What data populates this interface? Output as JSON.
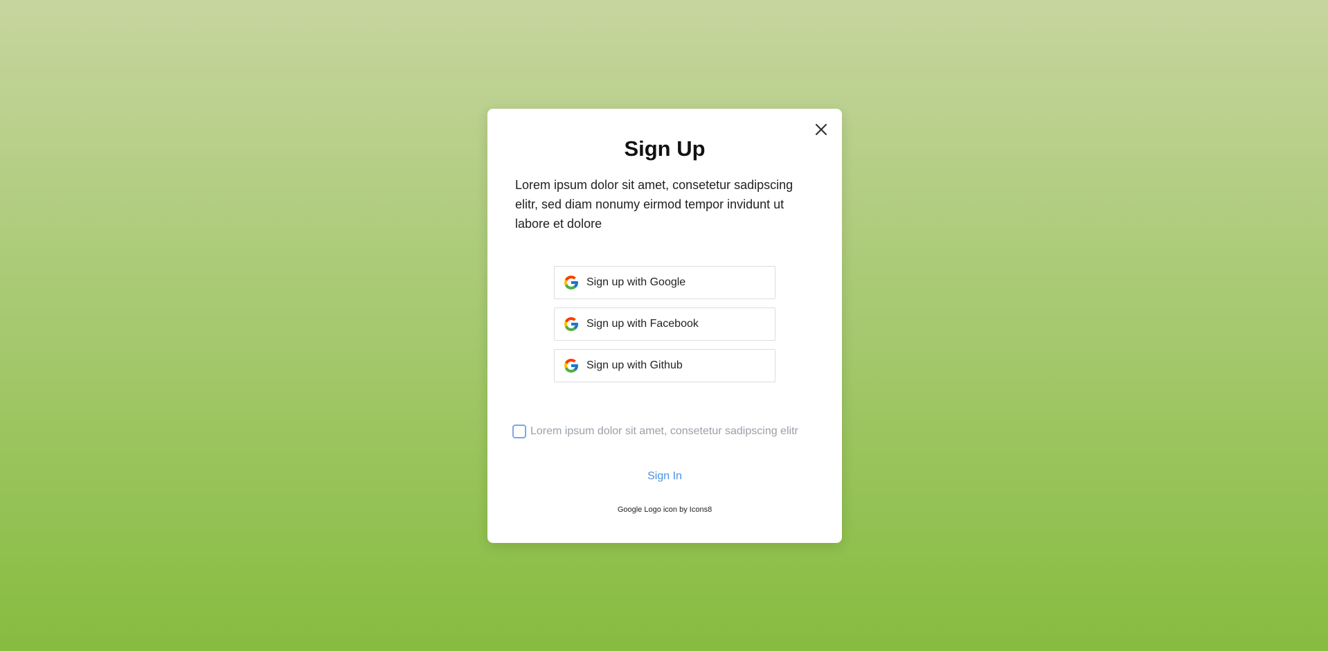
{
  "modal": {
    "title": "Sign Up",
    "description": "Lorem ipsum dolor sit amet, consetetur sadipscing elitr, sed diam nonumy eirmod tempor invidunt ut labore et dolore",
    "close_icon": "close-icon"
  },
  "providers": [
    {
      "label": "Sign up with Google",
      "icon": "google-logo-icon"
    },
    {
      "label": "Sign up with Facebook",
      "icon": "google-logo-icon"
    },
    {
      "label": "Sign up with Github",
      "icon": "google-logo-icon"
    }
  ],
  "consent": {
    "checked": false,
    "label": "Lorem ipsum dolor sit amet, consetetur sadipscing elitr"
  },
  "signin_link": "Sign In",
  "credit": "Google Logo icon by Icons8",
  "colors": {
    "link": "#4a90e2",
    "checkbox_border": "#7aa7e8",
    "background_top": "#c6d59e",
    "background_bottom": "#86bc3f"
  }
}
